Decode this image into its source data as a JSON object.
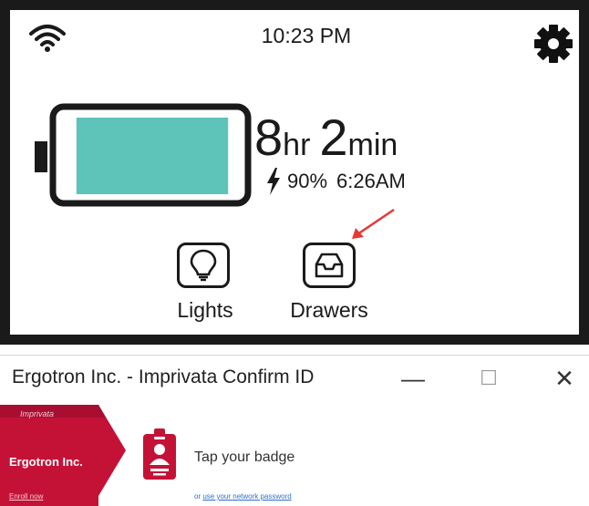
{
  "device": {
    "status": {
      "time": "10:23 PM",
      "wifi_icon": "wifi-icon",
      "settings_icon": "gear-icon"
    },
    "battery": {
      "fill_fraction": 0.9,
      "fill_color": "#5ec4b9",
      "hours": "8",
      "hours_unit": "hr",
      "minutes": "2",
      "minutes_unit": "min",
      "percent": "90%",
      "full_time": "6:26AM",
      "charging_icon": "lightning-bolt-icon"
    },
    "buttons": [
      {
        "label": "Lights",
        "icon": "lightbulb-icon"
      },
      {
        "label": "Drawers",
        "icon": "drawer-tray-icon"
      }
    ],
    "annotation_color": "#e53935"
  },
  "window": {
    "title": "Ergotron Inc. - Imprivata Confirm ID",
    "controls": {
      "minimize": "—",
      "maximize": "☐",
      "close": "✕"
    },
    "sidebar": {
      "brand": "Imprivata",
      "company": "Ergotron Inc.",
      "enroll_link": "Enroll now",
      "color": "#c41237"
    },
    "main": {
      "prompt": "Tap your badge",
      "alt_prefix": "or ",
      "alt_link": "use your network password",
      "badge_icon": "id-badge-icon"
    }
  }
}
